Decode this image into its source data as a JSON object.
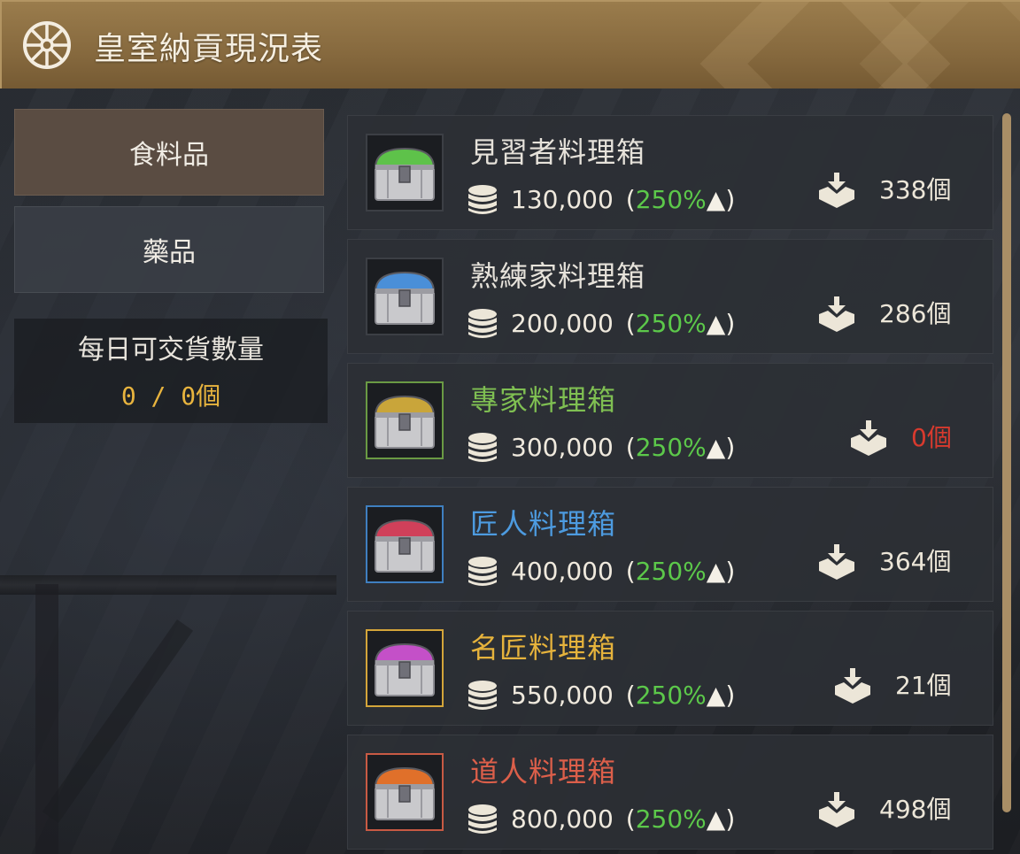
{
  "header": {
    "title": "皇室納貢現況表",
    "icon": "wheel-icon"
  },
  "sidebar": {
    "tabs": [
      {
        "label": "食料品",
        "active": true
      },
      {
        "label": "藥品",
        "active": false
      }
    ],
    "quota": {
      "label": "每日可交貨數量",
      "value": "0 / 0個"
    }
  },
  "items": [
    {
      "name": "見習者料理箱",
      "name_color": "#e6e2da",
      "price": "130,000",
      "pct": "250%",
      "stock": "338個",
      "chest_color": "#5ec24a",
      "frame_color": "#3c3f45"
    },
    {
      "name": "熟練家料理箱",
      "name_color": "#e6e2da",
      "price": "200,000",
      "pct": "250%",
      "stock": "286個",
      "chest_color": "#4a8fd8",
      "frame_color": "#3c3f45"
    },
    {
      "name": "專家料理箱",
      "name_color": "#7fbf52",
      "price": "300,000",
      "pct": "250%",
      "stock": "0個",
      "stock_zero": true,
      "chest_color": "#c9a53a",
      "frame_color": "#6a9a44"
    },
    {
      "name": "匠人料理箱",
      "name_color": "#4d9be0",
      "price": "400,000",
      "pct": "250%",
      "stock": "364個",
      "chest_color": "#d0405a",
      "frame_color": "#3f7fc0"
    },
    {
      "name": "名匠料理箱",
      "name_color": "#e6b33c",
      "price": "550,000",
      "pct": "250%",
      "stock": "21個",
      "chest_color": "#c450c8",
      "frame_color": "#d4a53a"
    },
    {
      "name": "道人料理箱",
      "name_color": "#dc5f4a",
      "price": "800,000",
      "pct": "250%",
      "stock": "498個",
      "chest_color": "#e0702a",
      "frame_color": "#c85a44"
    }
  ],
  "labels": {
    "up_arrow": "▲",
    "open_paren": "(",
    "close_paren": ")"
  }
}
